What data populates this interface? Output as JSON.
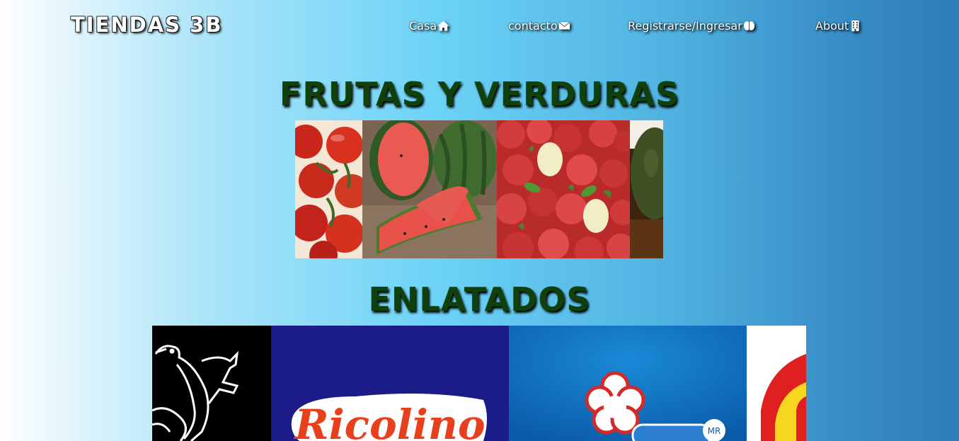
{
  "brand": "TIENDAS 3B",
  "nav": [
    {
      "label": "Casa",
      "icon": "home-icon"
    },
    {
      "label": "contacto",
      "icon": "envelope-icon"
    },
    {
      "label": "Registrarse/Ingresar",
      "icon": "brain-icon"
    },
    {
      "label": "About",
      "icon": "building-icon"
    }
  ],
  "sections": [
    {
      "title": "FRUTAS Y VERDURAS",
      "images": [
        "tomatoes-image",
        "watermelon-image",
        "apples-image",
        "avocado-image"
      ]
    },
    {
      "title": "ENLATADOS",
      "images": [
        "bird-logo-image",
        "ricolino-logo-image",
        "flower-logo-image",
        "red-logo-image"
      ],
      "logo_text": "Ricolino",
      "logo_mark": "MR"
    }
  ]
}
